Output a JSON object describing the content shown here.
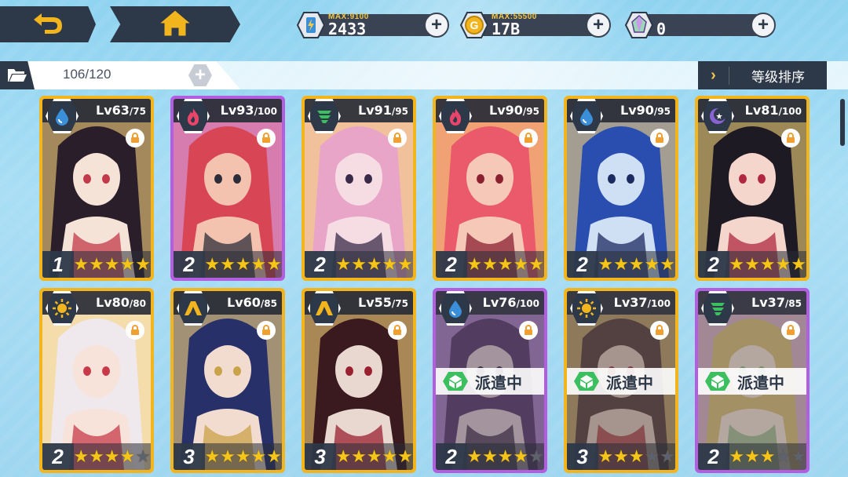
{
  "resources": [
    {
      "name": "stamina",
      "icon": "battery-icon",
      "max_label": "MAX:",
      "max_value": "9100",
      "value": "2433"
    },
    {
      "name": "gold",
      "icon": "coin-icon",
      "max_label": "MAX:",
      "max_value": "55500",
      "value": "17B"
    },
    {
      "name": "gems",
      "icon": "gem-icon",
      "max_label": "",
      "max_value": "",
      "value": "0"
    }
  ],
  "inventory": {
    "count": "106/120"
  },
  "sort": {
    "label": "等级排序"
  },
  "dispatch_label": "派遣中",
  "element_colors": {
    "water": "#3a8fd8",
    "fire": "#e8456a",
    "wind": "#3bbf5f",
    "dark": "#8a63d2",
    "light": "#f2b51e",
    "earth": "#f2b51e"
  },
  "cards": [
    {
      "element": "water",
      "level": "63",
      "max": "/75",
      "rank": "1",
      "stars": 5,
      "frame": "gold",
      "dispatched": false,
      "art": [
        "#2a1e2a",
        "#f6e3d8",
        "#c23a4a"
      ]
    },
    {
      "element": "fire",
      "level": "93",
      "max": "/100",
      "rank": "2",
      "stars": 5,
      "frame": "purple",
      "dispatched": false,
      "art": [
        "#d84555",
        "#f3c3b0",
        "#2d2d3a"
      ]
    },
    {
      "element": "wind",
      "level": "91",
      "max": "/95",
      "rank": "2",
      "stars": 5,
      "frame": "gold",
      "dispatched": false,
      "art": [
        "#e8a5c8",
        "#f6dde4",
        "#3a2a4a"
      ]
    },
    {
      "element": "fire",
      "level": "90",
      "max": "/95",
      "rank": "2",
      "stars": 5,
      "frame": "gold",
      "dispatched": false,
      "art": [
        "#ea5a6a",
        "#f5c8b8",
        "#8a2030"
      ]
    },
    {
      "element": "water",
      "level": "90",
      "max": "/95",
      "rank": "2",
      "stars": 5,
      "frame": "gold",
      "dispatched": false,
      "art": [
        "#2a4db0",
        "#cfe0f5",
        "#1b2a60"
      ]
    },
    {
      "element": "dark",
      "level": "81",
      "max": "/100",
      "rank": "2",
      "stars": 5,
      "frame": "gold",
      "dispatched": false,
      "art": [
        "#1e1a24",
        "#f4d6cc",
        "#b02840"
      ]
    },
    {
      "element": "light",
      "level": "80",
      "max": "/80",
      "rank": "2",
      "stars": 4,
      "frame": "gold",
      "dispatched": false,
      "art": [
        "#efe8ec",
        "#f7e3da",
        "#c83a4a"
      ]
    },
    {
      "element": "earth",
      "level": "60",
      "max": "/85",
      "rank": "3",
      "stars": 5,
      "frame": "gold",
      "dispatched": false,
      "art": [
        "#28306a",
        "#f2dccf",
        "#c9a24a"
      ]
    },
    {
      "element": "earth",
      "level": "55",
      "max": "/75",
      "rank": "3",
      "stars": 5,
      "frame": "gold",
      "dispatched": false,
      "art": [
        "#3a1a1e",
        "#e8d8d0",
        "#9a2030"
      ]
    },
    {
      "element": "water",
      "level": "76",
      "max": "/100",
      "rank": "2",
      "stars": 4,
      "frame": "purple",
      "dispatched": true,
      "art": [
        "#5a3a6a",
        "#d8bfc8",
        "#3a2540"
      ]
    },
    {
      "element": "light",
      "level": "37",
      "max": "/100",
      "rank": "3",
      "stars": 3,
      "frame": "gold",
      "dispatched": true,
      "art": [
        "#5a4038",
        "#d9c0b0",
        "#a03030"
      ]
    },
    {
      "element": "wind",
      "level": "37",
      "max": "/85",
      "rank": "2",
      "stars": 3,
      "frame": "purple",
      "dispatched": true,
      "art": [
        "#d6b870",
        "#f0dccb",
        "#8fb07a"
      ]
    }
  ]
}
